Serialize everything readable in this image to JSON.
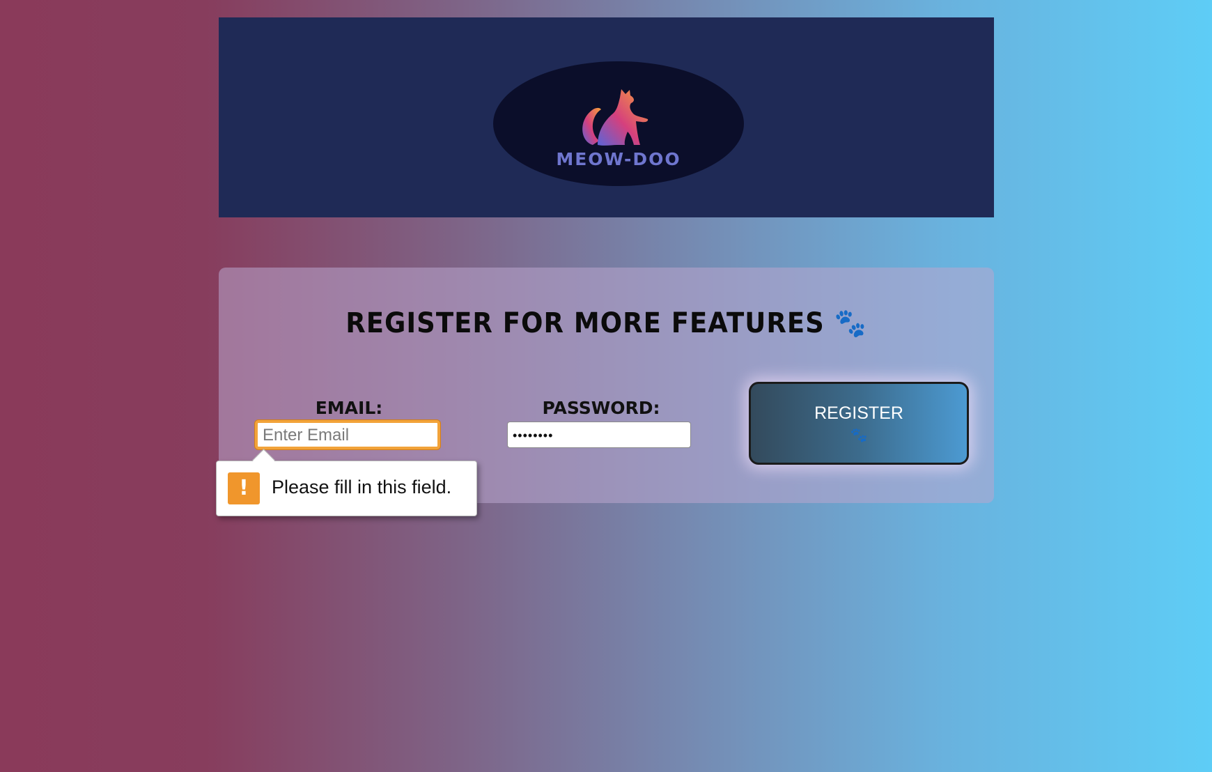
{
  "header": {
    "logo_text": "MEOW-DOO",
    "logo_icon": "cat-icon"
  },
  "form": {
    "title": "Register for more features",
    "title_icon": "🐾",
    "email_label": "Email:",
    "email_placeholder": "Enter Email",
    "email_value": "",
    "password_label": "Password:",
    "password_value": "••••••••",
    "register_label": "REGISTER",
    "register_icon": "🐾"
  },
  "validation": {
    "message": "Please fill in this field.",
    "icon": "!"
  },
  "colors": {
    "header_bg": "#1f2a56",
    "focus_ring": "#f2a33a",
    "warning": "#f0962c"
  }
}
